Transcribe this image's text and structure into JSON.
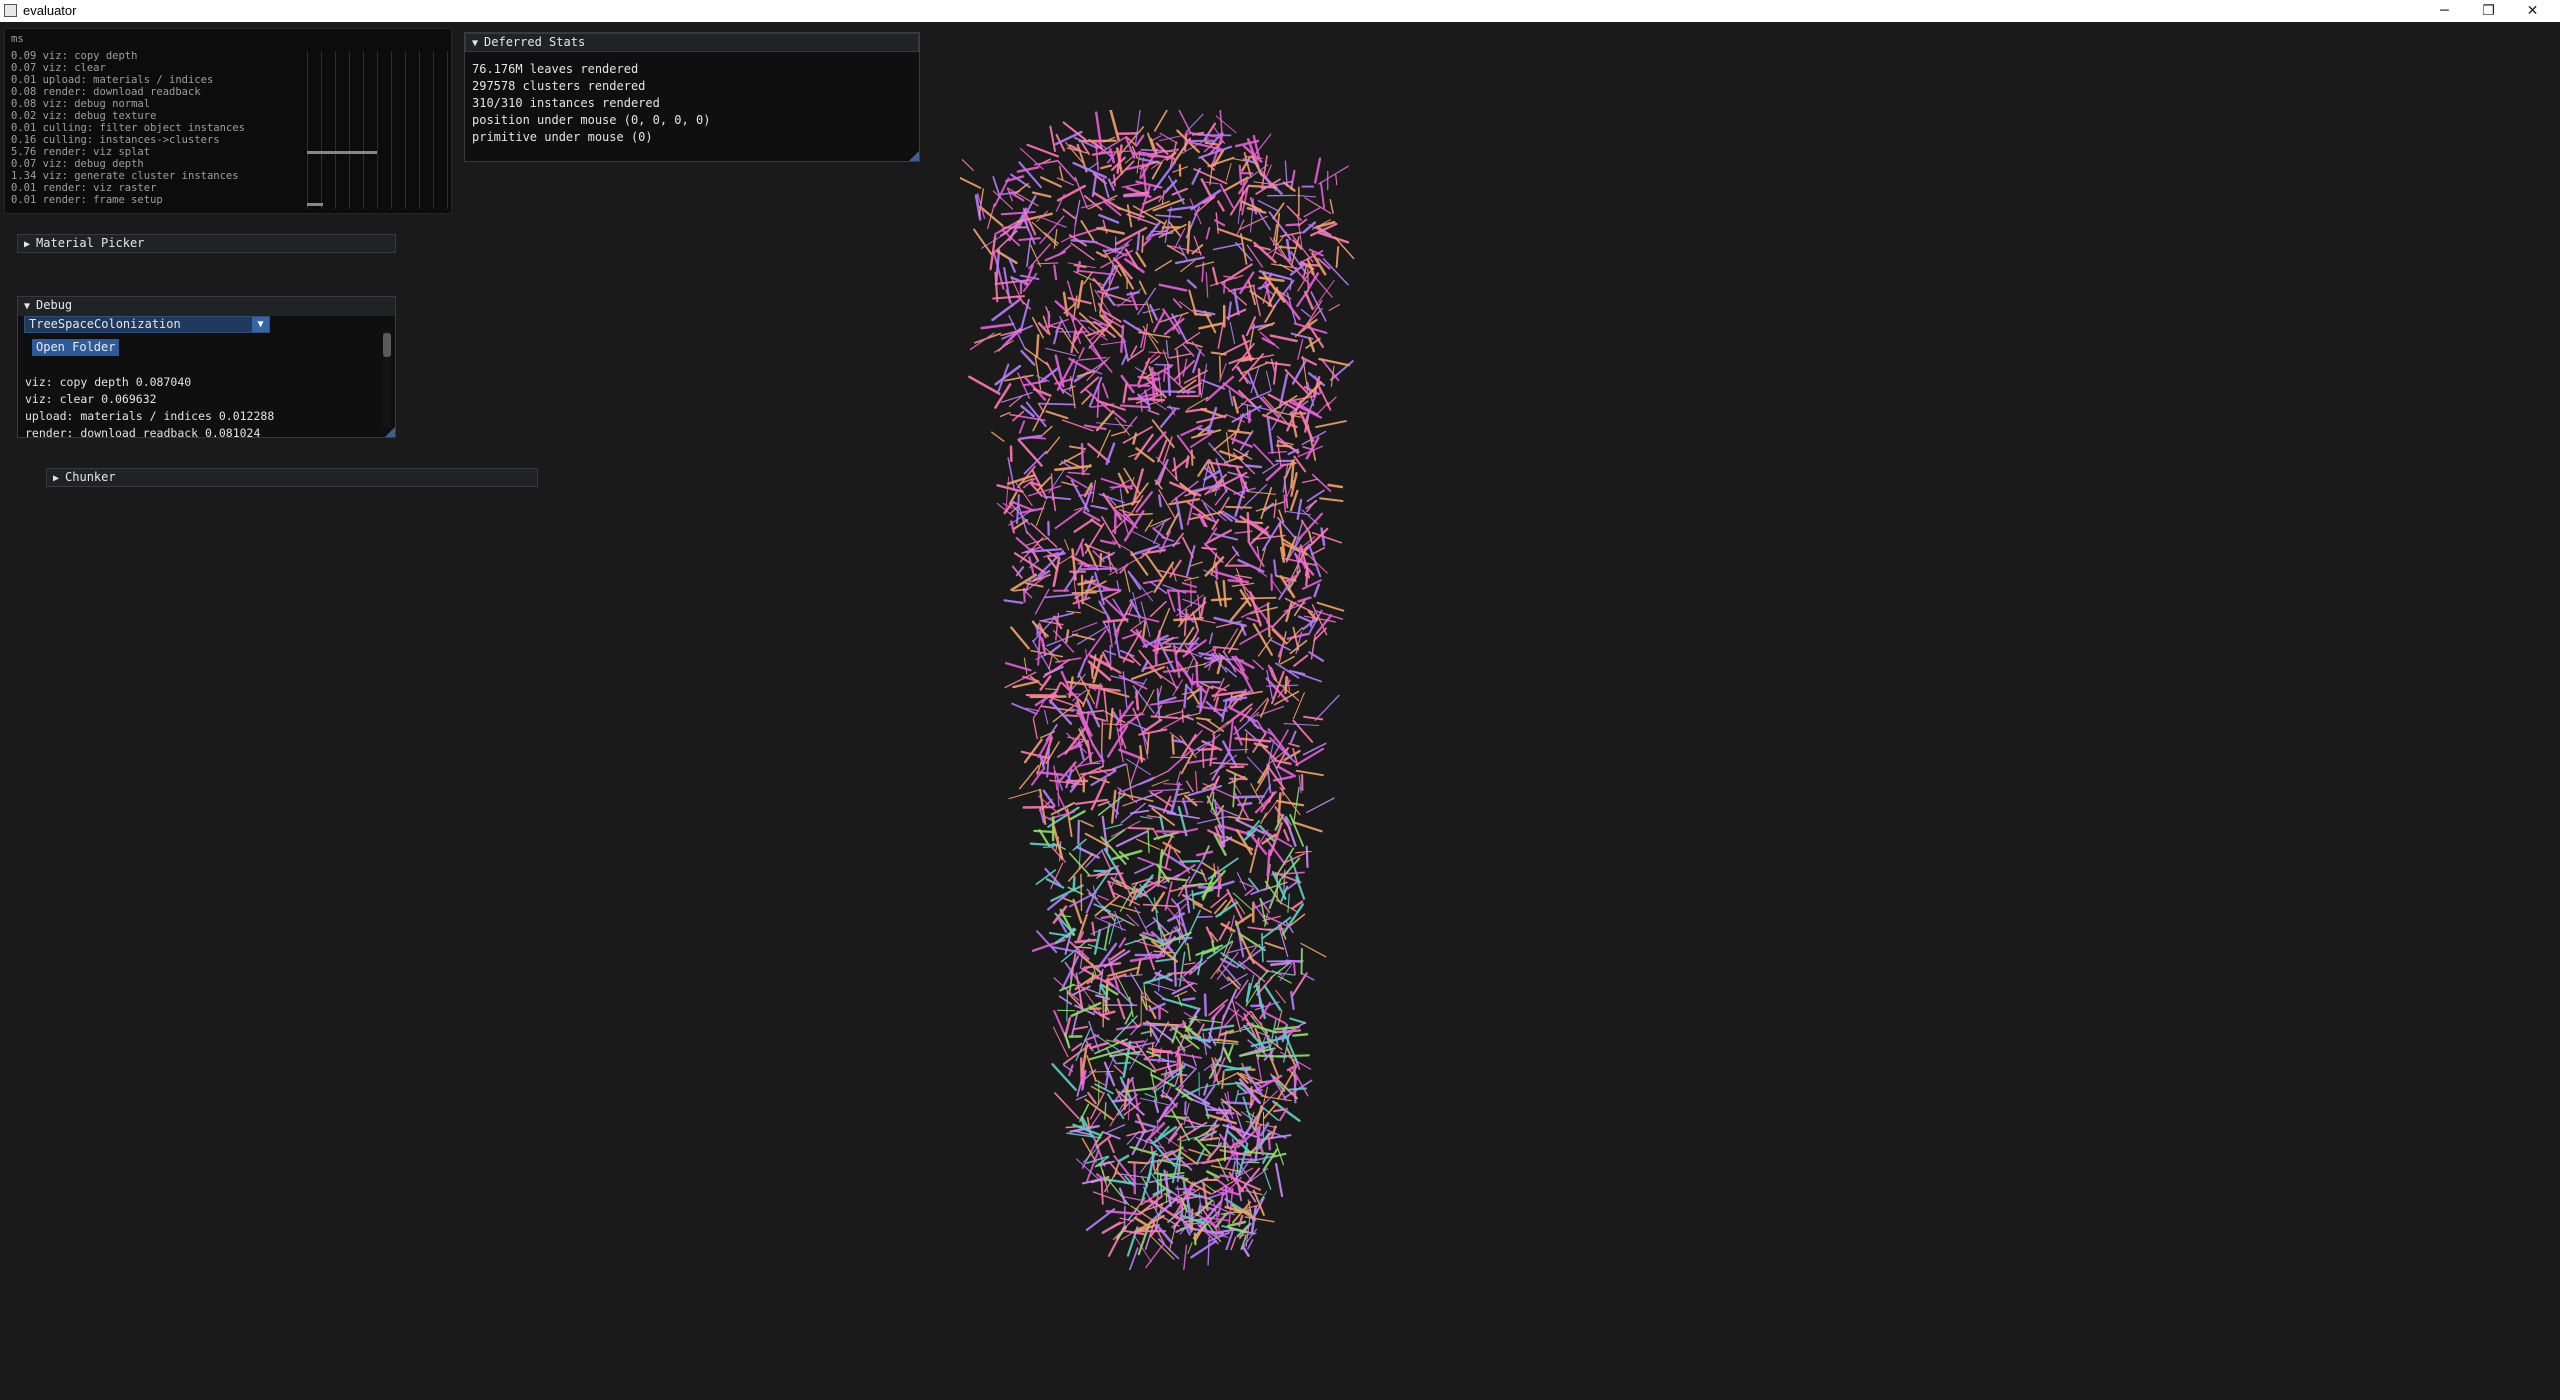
{
  "window": {
    "title": "evaluator",
    "controls": {
      "minimize": "─",
      "maximize": "❐",
      "close": "✕"
    }
  },
  "profiler": {
    "unit": "ms",
    "entries": [
      "0.09 viz: copy depth",
      "0.07 viz: clear",
      "0.01 upload: materials / indices",
      "0.08 render: download readback",
      "0.08 viz: debug normal",
      "0.02 viz: debug texture",
      "0.01 culling: filter object instances",
      "0.16 culling: instances->clusters",
      "5.76 render: viz splat",
      "0.07 viz: debug depth",
      "1.34 viz: generate cluster instances",
      "0.01 render: viz raster",
      "0.01 render: frame setup"
    ]
  },
  "deferred_stats": {
    "title": "Deferred Stats",
    "lines": [
      "76.176M leaves rendered",
      "297578 clusters rendered",
      "310/310 instances rendered",
      "position under mouse (0, 0, 0, 0)",
      "primitive under mouse (0)"
    ]
  },
  "material_picker": {
    "title": "Material Picker"
  },
  "debug": {
    "title": "Debug",
    "combo_value": "TreeSpaceColonization",
    "open_folder_label": "Open Folder",
    "lines": [
      "viz: copy depth 0.087040",
      "viz: clear 0.069632",
      "upload: materials / indices 0.012288",
      "render: download readback 0.081024"
    ]
  },
  "chunker": {
    "title": "Chunker"
  },
  "colors": {
    "background": "#1a1a1a",
    "header": "#202226",
    "combo": "#203a5e",
    "button": "#2d5b9a",
    "branch_palette": [
      "#e85fd6",
      "#ff7ab0",
      "#b57dff",
      "#f2a26a",
      "#8fe06a",
      "#5fd0c8",
      "#c98bff"
    ]
  }
}
